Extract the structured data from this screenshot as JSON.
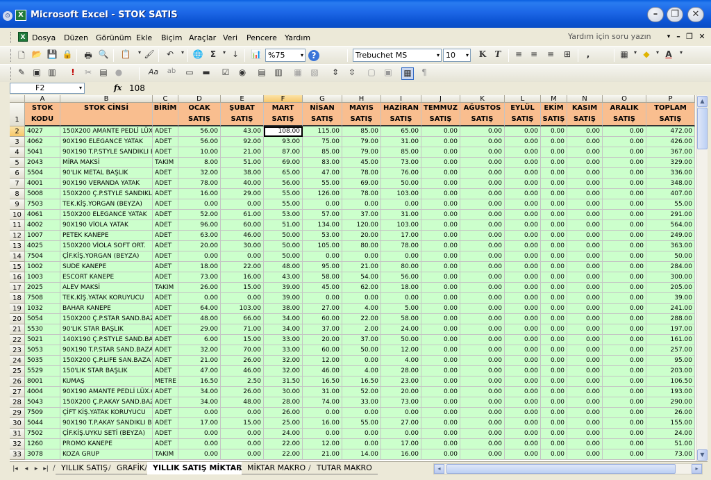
{
  "window": {
    "title": "Microsoft Excel - STOK SATIS",
    "app_icon": "excel-icon",
    "sysmenu_glyph": "⊙",
    "app_glyph": "X",
    "minimize": "–",
    "restore": "❐",
    "close": "✕"
  },
  "menu": {
    "items": [
      "Dosya",
      "Düzen",
      "Görünüm",
      "Ekle",
      "Biçim",
      "Araçlar",
      "Veri",
      "Pencere",
      "Yardım"
    ],
    "help_placeholder": "Yardım için soru yazın",
    "help_dd": "▾",
    "mdi_min": "–",
    "mdi_restore": "❐",
    "mdi_close": "✕"
  },
  "toolbar_standard": {
    "zoom": "%75",
    "font_name": "Trebuchet MS",
    "font_size": "10",
    "bold": "K",
    "italic": "T",
    "sigma": "Σ",
    "dd": "▾",
    "icons": {
      "new": "🗋",
      "open": "📂",
      "save": "💾",
      "perm": "🔒",
      "print": "🖶",
      "preview": "🔍",
      "spell": "✓",
      "paste": "📋",
      "format_painter": "🖌",
      "undo": "↶",
      "hyperlink": "🌐",
      "sort": "↓",
      "chart": "📊",
      "help": "?",
      "comma": ",",
      "align_left": "≡",
      "align_center": "≡",
      "align_right": "≡",
      "merge": "⊞",
      "borders": "▦",
      "fill": "◆",
      "font_color": "A"
    }
  },
  "toolbar_forms": {
    "icons": {
      "f1": "✎",
      "f2": "▣",
      "f3": "▥",
      "f4": "!",
      "f5": "✂",
      "f6": "▤",
      "f7": "●",
      "f8": "Aa",
      "f9": "ab",
      "f10": "▭",
      "f11": "▬",
      "f12": "☑",
      "f13": "◉",
      "f14": "▤",
      "f15": "▥",
      "f16": "▦",
      "f17": "▧",
      "f18": "⇕",
      "f19": "⇳",
      "f20": "▢",
      "f21": "▣",
      "f22": "▦",
      "f23": "¶"
    }
  },
  "formula_bar": {
    "cell_ref": "F2",
    "fx": "fx",
    "value": "108",
    "dd": "▾"
  },
  "columns": [
    "A",
    "B",
    "C",
    "D",
    "E",
    "F",
    "G",
    "H",
    "I",
    "J",
    "K",
    "L",
    "M",
    "N",
    "O",
    "P"
  ],
  "row_numbers": [
    "1",
    "2",
    "3",
    "4",
    "5",
    "6",
    "7",
    "8",
    "9",
    "10",
    "11",
    "12",
    "13",
    "14",
    "15",
    "16",
    "17",
    "18",
    "19",
    "20",
    "21",
    "22",
    "23",
    "24",
    "25",
    "26",
    "27",
    "28",
    "29",
    "30",
    "31",
    "32",
    "33"
  ],
  "header_row": [
    "STOK KODU",
    "STOK CİNSİ",
    "BİRİM",
    "OCAK SATIŞ",
    "ŞUBAT SATIŞ",
    "MART SATIŞ",
    "NİSAN SATIŞ",
    "MAYIS SATIŞ",
    "HAZİRAN SATIŞ",
    "TEMMUZ SATIŞ",
    "AĞUSTOS SATIŞ",
    "EYLÜL SATIŞ",
    "EKİM SATIŞ",
    "KASIM SATIŞ",
    "ARALIK SATIŞ",
    "TOPLAM SATIŞ"
  ],
  "rows": [
    [
      "4027",
      "150X200 AMANTE PEDLİ LÜX Ç",
      "ADET",
      "56.00",
      "43.00",
      "108.00",
      "115.00",
      "85.00",
      "65.00",
      "0.00",
      "0.00",
      "0.00",
      "0.00",
      "0.00",
      "0.00",
      "472.00"
    ],
    [
      "4062",
      "90X190 ELEGANCE YATAK",
      "ADET",
      "56.00",
      "92.00",
      "93.00",
      "75.00",
      "79.00",
      "31.00",
      "0.00",
      "0.00",
      "0.00",
      "0.00",
      "0.00",
      "0.00",
      "426.00"
    ],
    [
      "5041",
      "90X190 T.P.STYLE SANDIKLI BA",
      "ADET",
      "10.00",
      "21.00",
      "87.00",
      "85.00",
      "79.00",
      "85.00",
      "0.00",
      "0.00",
      "0.00",
      "0.00",
      "0.00",
      "0.00",
      "367.00"
    ],
    [
      "2043",
      "MİRA MAKSİ",
      "TAKIM",
      "8.00",
      "51.00",
      "69.00",
      "83.00",
      "45.00",
      "73.00",
      "0.00",
      "0.00",
      "0.00",
      "0.00",
      "0.00",
      "0.00",
      "329.00"
    ],
    [
      "5504",
      "90'LIK METAL BAŞLIK",
      "ADET",
      "32.00",
      "38.00",
      "65.00",
      "47.00",
      "78.00",
      "76.00",
      "0.00",
      "0.00",
      "0.00",
      "0.00",
      "0.00",
      "0.00",
      "336.00"
    ],
    [
      "4001",
      "90X190 VERANDA YATAK",
      "ADET",
      "78.00",
      "40.00",
      "56.00",
      "55.00",
      "69.00",
      "50.00",
      "0.00",
      "0.00",
      "0.00",
      "0.00",
      "0.00",
      "0.00",
      "348.00"
    ],
    [
      "5008",
      "150X200 Ç.P.STYLE SANDIKLI",
      "ADET",
      "16.00",
      "29.00",
      "55.00",
      "126.00",
      "78.00",
      "103.00",
      "0.00",
      "0.00",
      "0.00",
      "0.00",
      "0.00",
      "0.00",
      "407.00"
    ],
    [
      "7503",
      "TEK.KİŞ.YORGAN (BEYZA)",
      "ADET",
      "0.00",
      "0.00",
      "55.00",
      "0.00",
      "0.00",
      "0.00",
      "0.00",
      "0.00",
      "0.00",
      "0.00",
      "0.00",
      "0.00",
      "55.00"
    ],
    [
      "4061",
      "150X200 ELEGANCE YATAK",
      "ADET",
      "52.00",
      "61.00",
      "53.00",
      "57.00",
      "37.00",
      "31.00",
      "0.00",
      "0.00",
      "0.00",
      "0.00",
      "0.00",
      "0.00",
      "291.00"
    ],
    [
      "4002",
      "90X190 VİOLA YATAK",
      "ADET",
      "96.00",
      "60.00",
      "51.00",
      "134.00",
      "120.00",
      "103.00",
      "0.00",
      "0.00",
      "0.00",
      "0.00",
      "0.00",
      "0.00",
      "564.00"
    ],
    [
      "1007",
      "PETEK KANEPE",
      "ADET",
      "63.00",
      "46.00",
      "50.00",
      "53.00",
      "20.00",
      "17.00",
      "0.00",
      "0.00",
      "0.00",
      "0.00",
      "0.00",
      "0.00",
      "249.00"
    ],
    [
      "4025",
      "150X200 VİOLA SOFT ORT.",
      "ADET",
      "20.00",
      "30.00",
      "50.00",
      "105.00",
      "80.00",
      "78.00",
      "0.00",
      "0.00",
      "0.00",
      "0.00",
      "0.00",
      "0.00",
      "363.00"
    ],
    [
      "7504",
      "ÇİF.KİŞ.YORGAN (BEYZA)",
      "ADET",
      "0.00",
      "0.00",
      "50.00",
      "0.00",
      "0.00",
      "0.00",
      "0.00",
      "0.00",
      "0.00",
      "0.00",
      "0.00",
      "0.00",
      "50.00"
    ],
    [
      "1002",
      "SUDE KANEPE",
      "ADET",
      "18.00",
      "22.00",
      "48.00",
      "95.00",
      "21.00",
      "80.00",
      "0.00",
      "0.00",
      "0.00",
      "0.00",
      "0.00",
      "0.00",
      "284.00"
    ],
    [
      "1003",
      "ESCORT KANEPE",
      "ADET",
      "73.00",
      "16.00",
      "43.00",
      "58.00",
      "54.00",
      "56.00",
      "0.00",
      "0.00",
      "0.00",
      "0.00",
      "0.00",
      "0.00",
      "300.00"
    ],
    [
      "2025",
      "ALEV MAKSİ",
      "TAKIM",
      "26.00",
      "15.00",
      "39.00",
      "45.00",
      "62.00",
      "18.00",
      "0.00",
      "0.00",
      "0.00",
      "0.00",
      "0.00",
      "0.00",
      "205.00"
    ],
    [
      "7508",
      "TEK.KİŞ.YATAK KORUYUCU",
      "ADET",
      "0.00",
      "0.00",
      "39.00",
      "0.00",
      "0.00",
      "0.00",
      "0.00",
      "0.00",
      "0.00",
      "0.00",
      "0.00",
      "0.00",
      "39.00"
    ],
    [
      "1032",
      "BAHAR KANEPE",
      "ADET",
      "64.00",
      "103.00",
      "38.00",
      "27.00",
      "4.00",
      "5.00",
      "0.00",
      "0.00",
      "0.00",
      "0.00",
      "0.00",
      "0.00",
      "241.00"
    ],
    [
      "5054",
      "150X200 Ç.P.STAR SAND.BAZ",
      "ADET",
      "48.00",
      "66.00",
      "34.00",
      "60.00",
      "22.00",
      "58.00",
      "0.00",
      "0.00",
      "0.00",
      "0.00",
      "0.00",
      "0.00",
      "288.00"
    ],
    [
      "5530",
      "90'LIK STAR BAŞLIK",
      "ADET",
      "29.00",
      "71.00",
      "34.00",
      "37.00",
      "2.00",
      "24.00",
      "0.00",
      "0.00",
      "0.00",
      "0.00",
      "0.00",
      "0.00",
      "197.00"
    ],
    [
      "5021",
      "140X190 Ç.P.STYLE SAND.BAZ",
      "ADET",
      "6.00",
      "15.00",
      "33.00",
      "20.00",
      "37.00",
      "50.00",
      "0.00",
      "0.00",
      "0.00",
      "0.00",
      "0.00",
      "0.00",
      "161.00"
    ],
    [
      "5053",
      "90X190 T.P.STAR SAND.BAZA",
      "ADET",
      "32.00",
      "70.00",
      "33.00",
      "60.00",
      "50.00",
      "12.00",
      "0.00",
      "0.00",
      "0.00",
      "0.00",
      "0.00",
      "0.00",
      "257.00"
    ],
    [
      "5035",
      "150X200 Ç.P.LIFE SAN.BAZA",
      "ADET",
      "21.00",
      "26.00",
      "32.00",
      "12.00",
      "0.00",
      "4.00",
      "0.00",
      "0.00",
      "0.00",
      "0.00",
      "0.00",
      "0.00",
      "95.00"
    ],
    [
      "5529",
      "150'LIK STAR BAŞLIK",
      "ADET",
      "47.00",
      "46.00",
      "32.00",
      "46.00",
      "4.00",
      "28.00",
      "0.00",
      "0.00",
      "0.00",
      "0.00",
      "0.00",
      "0.00",
      "203.00"
    ],
    [
      "8001",
      "KUMAŞ",
      "METRE",
      "16.50",
      "2.50",
      "31.50",
      "16.50",
      "16.50",
      "23.00",
      "0.00",
      "0.00",
      "0.00",
      "0.00",
      "0.00",
      "0.00",
      "106.50"
    ],
    [
      "4004",
      "90X190 AMANTE PEDLİ LÜX.O",
      "ADET",
      "34.00",
      "26.00",
      "30.00",
      "31.00",
      "52.00",
      "20.00",
      "0.00",
      "0.00",
      "0.00",
      "0.00",
      "0.00",
      "0.00",
      "193.00"
    ],
    [
      "5043",
      "150X200 Ç.P.AKAY SAND.BAZ",
      "ADET",
      "34.00",
      "48.00",
      "28.00",
      "74.00",
      "33.00",
      "73.00",
      "0.00",
      "0.00",
      "0.00",
      "0.00",
      "0.00",
      "0.00",
      "290.00"
    ],
    [
      "7509",
      "ÇİFT KİŞ.YATAK KORUYUCU",
      "ADET",
      "0.00",
      "0.00",
      "26.00",
      "0.00",
      "0.00",
      "0.00",
      "0.00",
      "0.00",
      "0.00",
      "0.00",
      "0.00",
      "0.00",
      "26.00"
    ],
    [
      "5044",
      "90X190 T.P.AKAY SANDIKLI B",
      "ADET",
      "17.00",
      "15.00",
      "25.00",
      "16.00",
      "55.00",
      "27.00",
      "0.00",
      "0.00",
      "0.00",
      "0.00",
      "0.00",
      "0.00",
      "155.00"
    ],
    [
      "7502",
      "ÇİF.KİŞ.UYKU SETİ (BEYZA)",
      "ADET",
      "0.00",
      "0.00",
      "24.00",
      "0.00",
      "0.00",
      "0.00",
      "0.00",
      "0.00",
      "0.00",
      "0.00",
      "0.00",
      "0.00",
      "24.00"
    ],
    [
      "1260",
      "PROMO KANEPE",
      "ADET",
      "0.00",
      "0.00",
      "22.00",
      "12.00",
      "0.00",
      "17.00",
      "0.00",
      "0.00",
      "0.00",
      "0.00",
      "0.00",
      "0.00",
      "51.00"
    ],
    [
      "3078",
      "KOZA GRUP",
      "TAKIM",
      "0.00",
      "0.00",
      "22.00",
      "21.00",
      "14.00",
      "16.00",
      "0.00",
      "0.00",
      "0.00",
      "0.00",
      "0.00",
      "0.00",
      "73.00"
    ]
  ],
  "sheet_tabs": [
    "YILLIK SATIŞ",
    "GRAFİK",
    "YILLIK SATIŞ MİKTAR",
    "MİKTAR MAKRO",
    "TUTAR MAKRO"
  ],
  "active_tab": "YILLIK SATIŞ MİKTAR",
  "nav": {
    "first": "|◂",
    "prev": "◂",
    "next": "▸",
    "last": "▸|"
  },
  "scroll": {
    "up": "▲",
    "down": "▼",
    "left": "◂",
    "right": "▸"
  },
  "colors": {
    "title_bar": "#0a5fe0",
    "header_fill": "#f9be8f",
    "data_fill": "#ccffcc",
    "chrome": "#ece9d8"
  }
}
